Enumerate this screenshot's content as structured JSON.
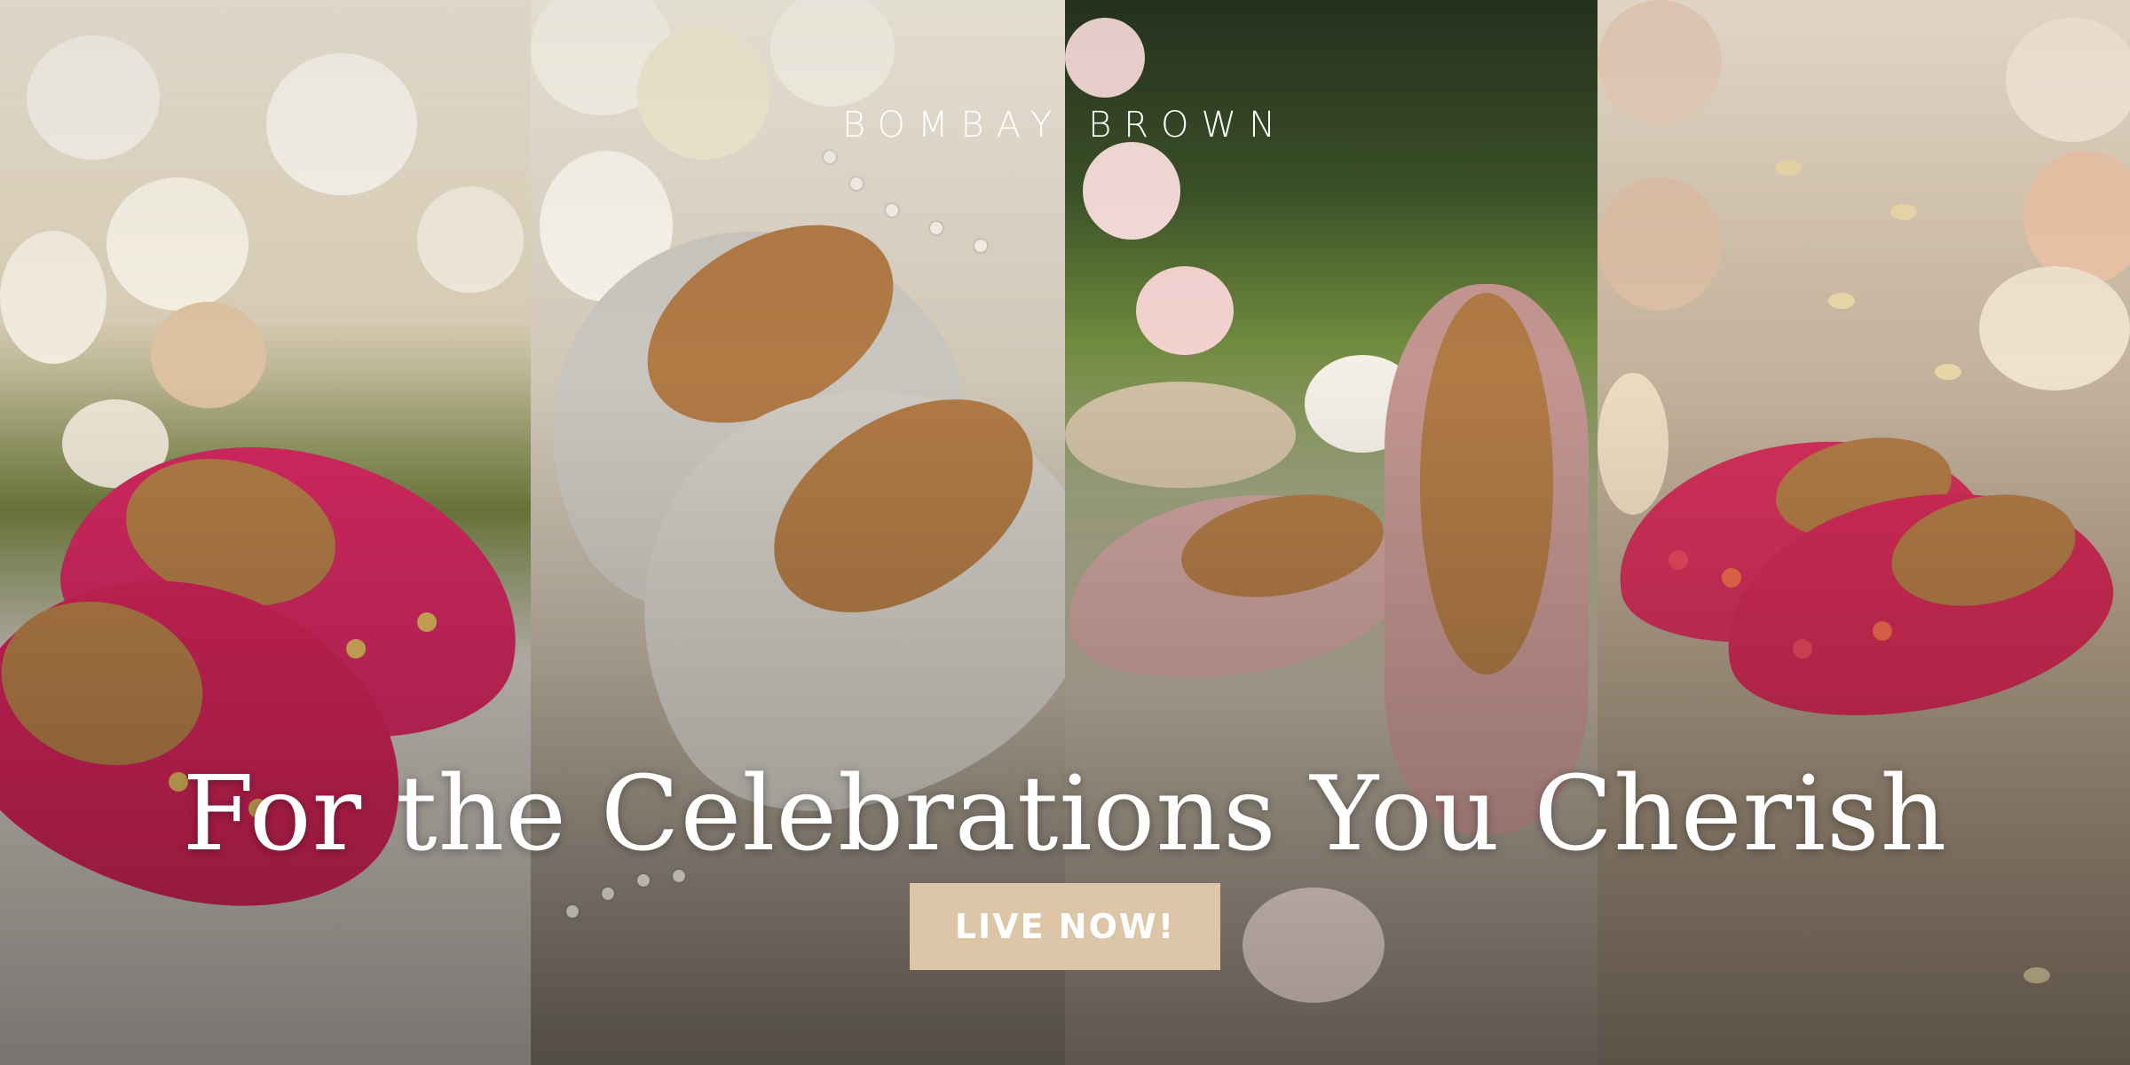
{
  "brand": "BOMBAY BROWN",
  "headline": "For the Celebrations You Cherish",
  "cta_label": "LIVE NOW!",
  "colors": {
    "cta_background": "#ddc6a8",
    "text": "#ffffff",
    "pink_shoe": "#d0285f",
    "silver_shoe": "#c9c6bf",
    "blush_shoe": "#caa09b",
    "rose_shoe": "#d2305a",
    "shoe_lining": "#b07a45"
  }
}
